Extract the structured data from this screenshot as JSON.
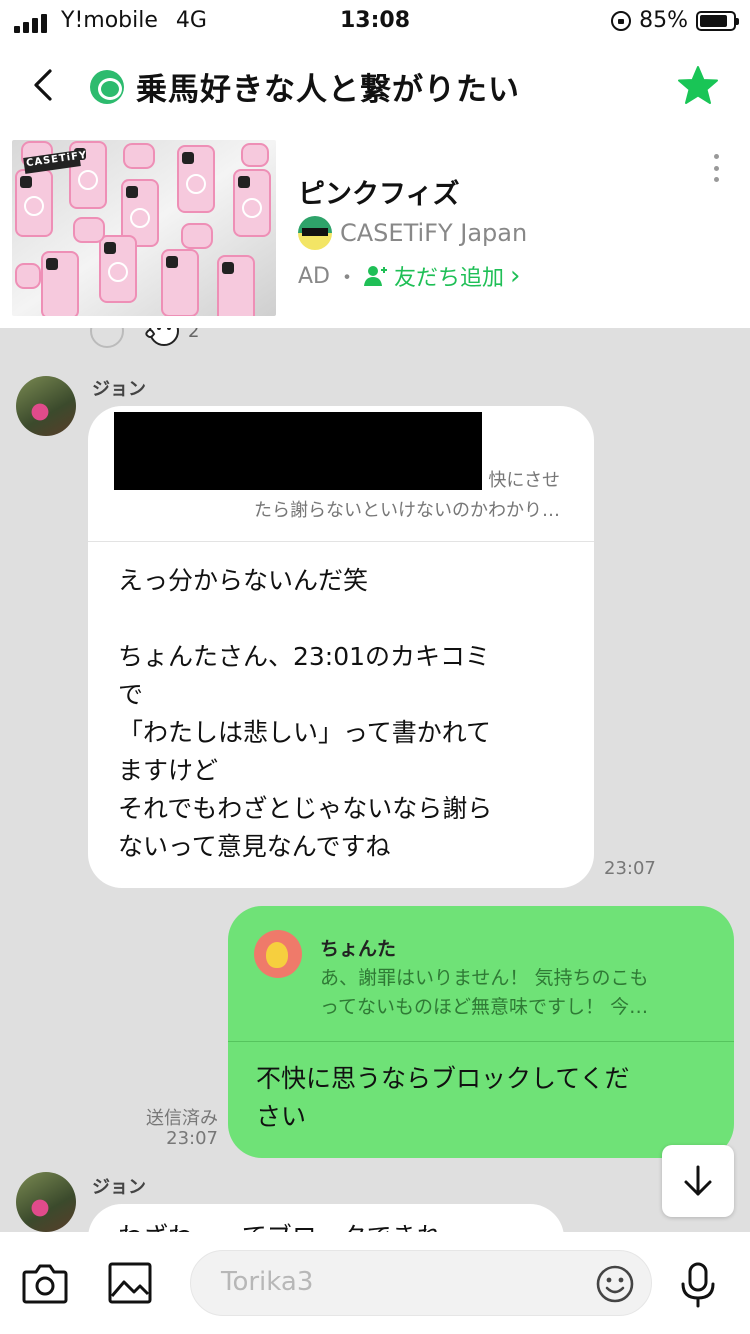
{
  "status_bar": {
    "carrier": "Y!mobile",
    "network": "4G",
    "time": "13:08",
    "battery": "85%"
  },
  "header": {
    "title": "乗馬好きな人と繋がりたい"
  },
  "ad": {
    "title": "ピンクフィズ",
    "brand": "CASETiFY Japan",
    "ad_label": "AD",
    "separator": "・",
    "add_friend": "友だち追加",
    "chevron": "›",
    "image_label": "CASETiFY"
  },
  "reactions": {
    "count": "2"
  },
  "messages": [
    {
      "sender": "ジョン",
      "quote_line1": "快にさせ",
      "quote_line2": "たら謝らないといけないのかわかり…",
      "text": "えっ分からないんだ笑\n\nちょんたさん、23:01のカキコミ\nで\n「わたしは悲しい」って書かれて\nますけど\nそれでもわざとじゃないなら謝ら\nないって意見なんですね",
      "time": "23:07"
    },
    {
      "quote_name": "ちょんた",
      "quote_text": "あ、謝罪はいりません！ 気持ちのこも\nってないものほど無意味ですし！ 今…",
      "text": "不快に思うならブロックしてくだ\nさい",
      "read_status": "送信済み",
      "time": "23:07"
    },
    {
      "sender": "ジョン",
      "text": "わざわ…ってブロ…クできれ"
    }
  ],
  "input": {
    "placeholder": "Torika3"
  },
  "colors": {
    "outgoing_bubble": "#6fe277",
    "accent_green": "#1fbf56",
    "star": "#19c556"
  }
}
